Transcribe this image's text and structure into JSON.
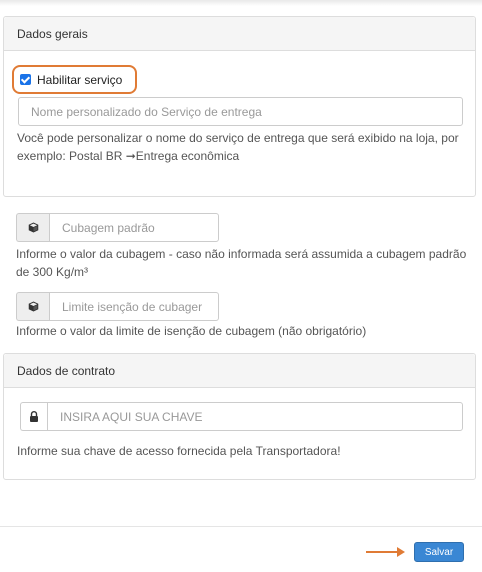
{
  "general": {
    "heading": "Dados gerais",
    "enable_service_label": "Habilitar serviço",
    "enable_service_checked": true,
    "service_name_placeholder": "Nome personalizado do Serviço de entrega",
    "service_name_help_line1": "Você pode personalizar o nome do serviço de entrega que será exibido na loja, por",
    "service_name_help_line2": "exemplo: Postal BR ➞Entrega econômica"
  },
  "cubage": {
    "placeholder": "Cubagem padrão",
    "icon": "cube-icon",
    "help_line1": "Informe o valor da cubagem - caso não informada será assumida a cubagem padrão",
    "help_line2": "de 300 Kg/m³"
  },
  "cubage_limit": {
    "placeholder": "Limite isenção de cubager",
    "icon": "cube-icon",
    "help": "Informe o valor da limite de isenção de cubagem (não obrigatório)"
  },
  "contract": {
    "heading": "Dados de contrato",
    "key_placeholder": "INSIRA AQUI SUA CHAVE",
    "icon": "lock-icon",
    "help": "Informe sua chave de acesso fornecida pela Transportadora!"
  },
  "footer": {
    "save_label": "Salvar"
  },
  "colors": {
    "highlight": "#e07b35",
    "primary": "#3a87d4"
  }
}
